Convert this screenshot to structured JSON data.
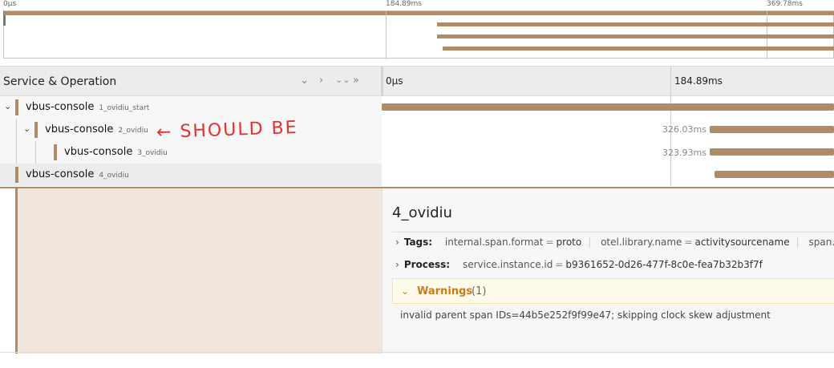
{
  "minimap": {
    "ticks": [
      "0µs",
      "184.89ms",
      "369.78ms"
    ]
  },
  "header": {
    "title": "Service & Operation",
    "controls": [
      "⌄",
      "›",
      "⌄⌄",
      "»"
    ],
    "ticks": [
      "0µs",
      "184.89ms"
    ]
  },
  "rows": [
    {
      "service": "vbus-console",
      "operation": "1_ovidiu_start"
    },
    {
      "service": "vbus-console",
      "operation": "2_ovidiu",
      "duration": "326.03ms"
    },
    {
      "service": "vbus-console",
      "operation": "3_ovidiu",
      "duration": "323.93ms"
    },
    {
      "service": "vbus-console",
      "operation": "4_ovidiu"
    }
  ],
  "annotation": "← SHOULD BE",
  "detail": {
    "title": "4_ovidiu",
    "tags_label": "Tags:",
    "tags": [
      {
        "key": "internal.span.format",
        "value": "proto"
      },
      {
        "key": "otel.library.name",
        "value": "activitysourcename"
      },
      {
        "key": "span.k",
        "value": ""
      }
    ],
    "process_label": "Process:",
    "process": [
      {
        "key": "service.instance.id",
        "value": "b9361652-0d26-477f-8c0e-fea7b32b3f7f"
      }
    ],
    "warnings_label": "Warnings",
    "warnings_count": "(1)",
    "warning_text": "invalid parent span IDs=44b5e252f9f99e47; skipping clock skew adjustment"
  },
  "colors": {
    "span": "#b08b68",
    "warning": "#c77d1b",
    "annotation": "#e53030"
  }
}
